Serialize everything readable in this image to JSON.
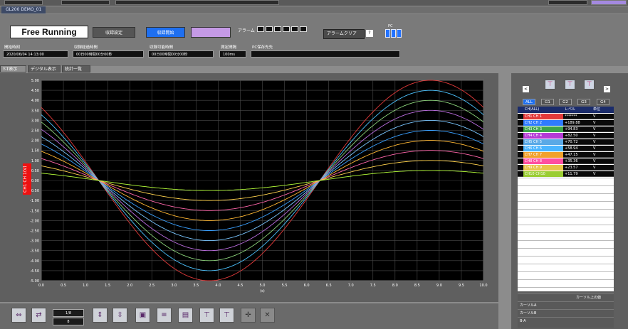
{
  "window": {
    "app_tab": "GL200 DEMO_01"
  },
  "header": {
    "mode": "Free Running",
    "btn_settings": "収録設定",
    "btn_start": "収録開始",
    "btn_stop": "",
    "frame_label": "アラーム",
    "frame_clear": "アラームクリア",
    "help": "?",
    "pc_label": "PC",
    "colors": {
      "start": "#1e6ff0",
      "stop": "#c59ae6"
    }
  },
  "info": {
    "start_time_label": "開始時刻",
    "start_time": "2020/06/04 14:13:00",
    "elapsed_label": "収録経過時間",
    "elapsed": "00日00時間00分00秒",
    "remaining_label": "収録可能時間",
    "remaining": "00日00時間00分00秒",
    "interval_label": "測定間隔",
    "interval": "100ms",
    "pc_dest_label": "PC保存先先",
    "pc_dest": ""
  },
  "view_tabs": [
    {
      "label": "Y-T表示",
      "active": true
    },
    {
      "label": "デジタル表示",
      "active": false
    },
    {
      "label": "統計一覧",
      "active": false
    }
  ],
  "chart_data": {
    "type": "line",
    "x_ticks": [
      "0.0",
      "0.5",
      "1.0",
      "1.5",
      "2.0",
      "2.5",
      "3.0",
      "3.5",
      "4.0",
      "4.5",
      "5.0",
      "5.5",
      "6.0",
      "6.5",
      "7.0",
      "7.5",
      "8.0",
      "8.5",
      "9.0",
      "9.5",
      "10.0"
    ],
    "y_ticks": [
      "5.00",
      "4.50",
      "4.00",
      "3.50",
      "3.00",
      "2.50",
      "2.00",
      "1.50",
      "1.00",
      "0.50",
      "0.00",
      "-0.50",
      "-1.00",
      "-1.50",
      "-2.00",
      "-2.50",
      "-3.00",
      "-3.50",
      "-4.00",
      "-4.50",
      "-5.00"
    ],
    "xlim": [
      0,
      10
    ],
    "ylim": [
      -5,
      5
    ],
    "xlabel": "(s)",
    "series": [
      {
        "name": "CH1",
        "color": "#e23a3a",
        "amplitude": 5.0
      },
      {
        "name": "CH2",
        "color": "#4cc3ff",
        "amplitude": 4.5
      },
      {
        "name": "CH3",
        "color": "#8bd27a",
        "amplitude": 4.0
      },
      {
        "name": "CH4",
        "color": "#b86bdc",
        "amplitude": 3.5
      },
      {
        "name": "CH5",
        "color": "#7ac6ff",
        "amplitude": 3.0
      },
      {
        "name": "CH6",
        "color": "#3aa0ff",
        "amplitude": 2.5
      },
      {
        "name": "CH7",
        "color": "#ffb733",
        "amplitude": 2.0
      },
      {
        "name": "CH8",
        "color": "#ff66aa",
        "amplitude": 1.5
      },
      {
        "name": "CH9",
        "color": "#ffd24d",
        "amplitude": 1.0
      },
      {
        "name": "CH10",
        "color": "#b6ff3a",
        "amplitude": 0.5
      }
    ],
    "period_s": 10,
    "phase_zero_s": 1.3
  },
  "side": {
    "groups": [
      {
        "label": "ALL",
        "active": true
      },
      {
        "label": "G1",
        "active": false
      },
      {
        "label": "G2",
        "active": false
      },
      {
        "label": "G3",
        "active": false
      },
      {
        "label": "G4",
        "active": false
      }
    ],
    "table": {
      "headers": [
        "CH(ALL)",
        "レベル",
        "単位"
      ],
      "rows": [
        {
          "name": "CH1 CH 1",
          "level": "*******",
          "unit": "V",
          "color": "#e23a3a"
        },
        {
          "name": "CH2 CH 2",
          "level": "+189.88",
          "unit": "V",
          "color": "#2f7bff"
        },
        {
          "name": "CH3 CH 3",
          "level": "+94.83",
          "unit": "V",
          "color": "#3ca34a"
        },
        {
          "name": "CH4 CH 4",
          "level": "+82.50",
          "unit": "V",
          "color": "#b53bd6"
        },
        {
          "name": "CH5 CH 5",
          "level": "+70.72",
          "unit": "V",
          "color": "#5aa9e6"
        },
        {
          "name": "CH6 CH 6",
          "level": "+58.94",
          "unit": "V",
          "color": "#4bb5ff"
        },
        {
          "name": "CH7 CH 7",
          "level": "+47.15",
          "unit": "V",
          "color": "#f2a12b"
        },
        {
          "name": "CH8 CH 8",
          "level": "+35.36",
          "unit": "V",
          "color": "#ff4fa0"
        },
        {
          "name": "CH9 CH 9",
          "level": "+23.57",
          "unit": "V",
          "color": "#e8c64a"
        },
        {
          "name": "CH10 CH10",
          "level": "+11.79",
          "unit": "V",
          "color": "#9acd32"
        }
      ]
    },
    "stats": {
      "title": "カーソル上の値",
      "rows": [
        "カーソルA",
        "カーソルB",
        "B-A"
      ]
    }
  },
  "toolbar": {
    "select_top": "1/8",
    "select_bottom": "8"
  },
  "ch_indicator": "CH1 CH 1(V)"
}
